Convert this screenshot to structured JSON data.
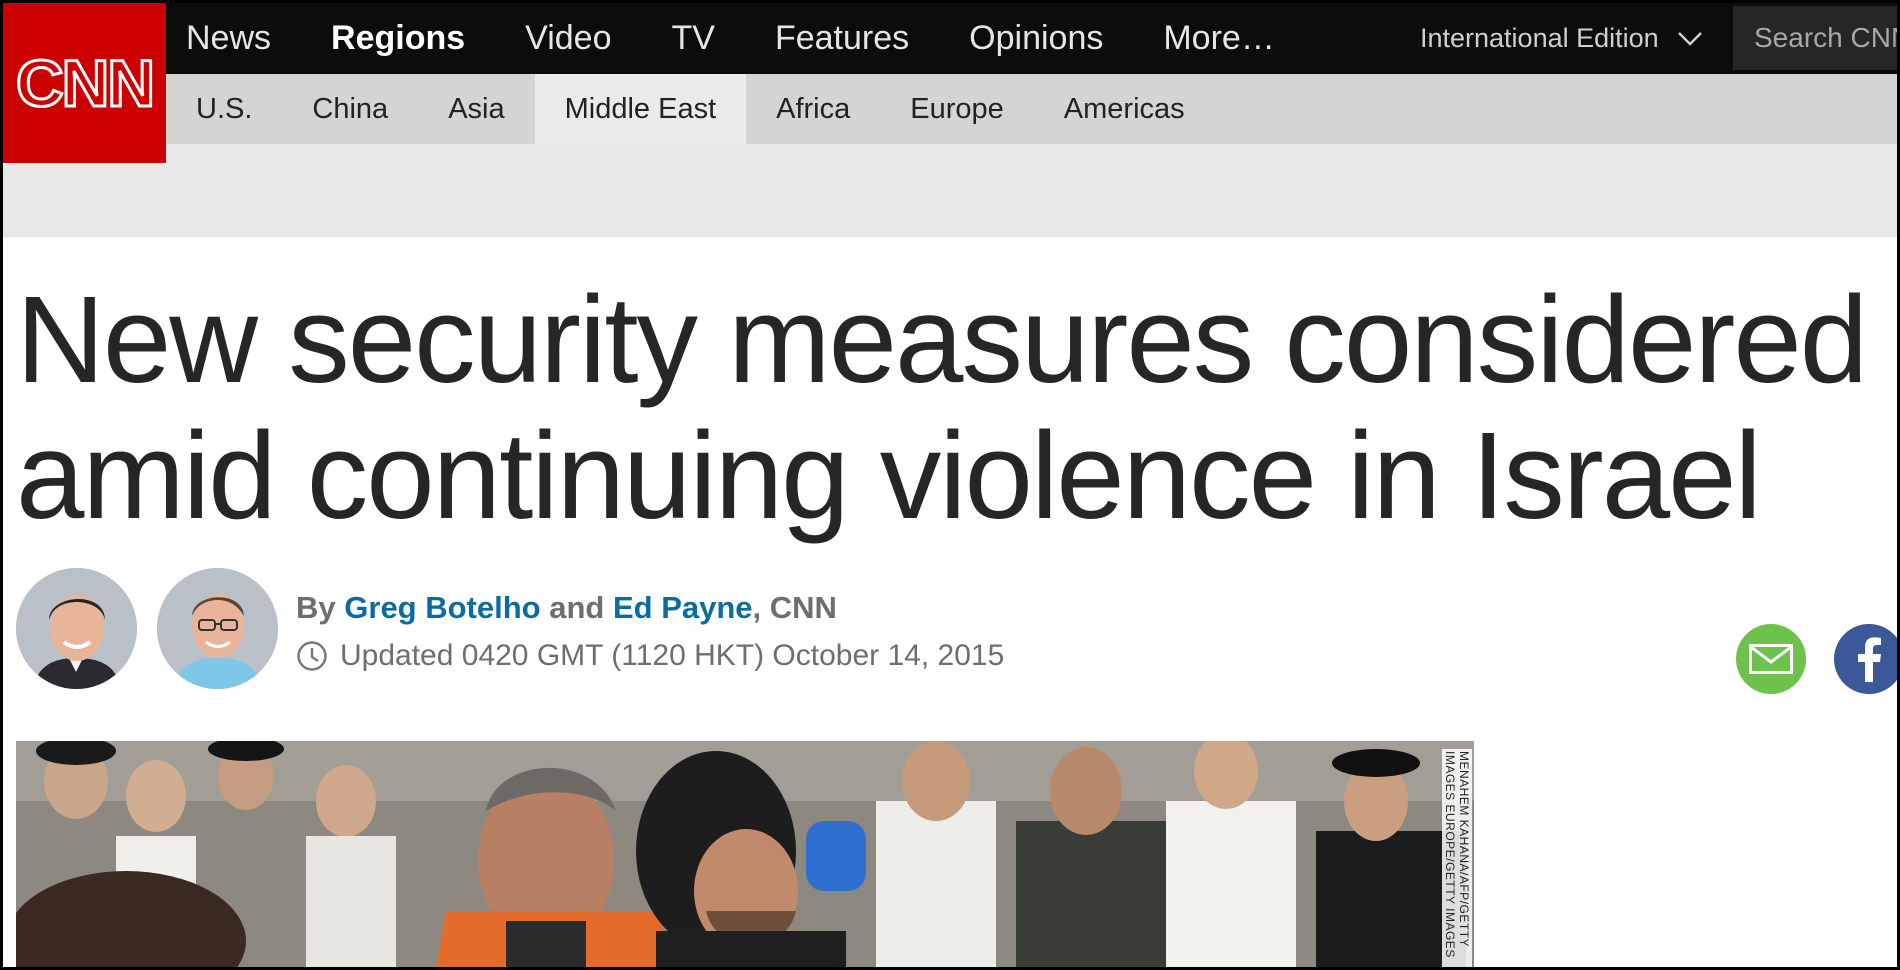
{
  "brand": {
    "logo_text": "CNN",
    "color": "#cc0000"
  },
  "nav": {
    "items": [
      {
        "label": "News",
        "active": false
      },
      {
        "label": "Regions",
        "active": true
      },
      {
        "label": "Video",
        "active": false
      },
      {
        "label": "TV",
        "active": false
      },
      {
        "label": "Features",
        "active": false
      },
      {
        "label": "Opinions",
        "active": false
      },
      {
        "label": "More…",
        "active": false
      }
    ],
    "edition": "International Edition",
    "search_placeholder": "Search CNN"
  },
  "subnav": {
    "items": [
      {
        "label": "U.S.",
        "active": false
      },
      {
        "label": "China",
        "active": false
      },
      {
        "label": "Asia",
        "active": false
      },
      {
        "label": "Middle East",
        "active": true
      },
      {
        "label": "Africa",
        "active": false
      },
      {
        "label": "Europe",
        "active": false
      },
      {
        "label": "Americas",
        "active": false
      }
    ]
  },
  "article": {
    "headline": "New security measures considered amid continuing violence in Israel",
    "byline": {
      "prefix": "By",
      "author1": "Greg Botelho",
      "conjunction": "and",
      "author2": "Ed Payne",
      "suffix": ", CNN"
    },
    "updated": "Updated 0420 GMT (1120 HKT) October 14, 2015",
    "photo_credit": "MENAHEM KAHANA/AFP/GETTY IMAGES EUROPE/GETTY IMAGES"
  },
  "share": {
    "email_icon": "envelope-icon",
    "facebook_icon": "facebook-icon",
    "email_color": "#6cc24a",
    "facebook_color": "#3b5998"
  }
}
